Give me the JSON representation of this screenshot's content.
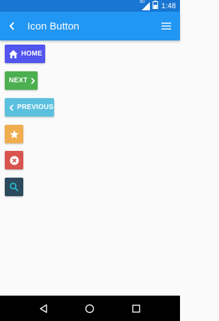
{
  "status_bar": {
    "network": "3G",
    "time": "1:48"
  },
  "app_bar": {
    "title": "Icon Button",
    "back_icon": "chevron-left-icon",
    "menu_icon": "hamburger-menu-icon"
  },
  "buttons": {
    "home": {
      "label": "HOME",
      "icon": "home-icon",
      "color": "#5255ee"
    },
    "next": {
      "label": "NEXT",
      "icon": "chevron-right-icon",
      "color": "#4caf50"
    },
    "previous": {
      "label": "PREVIOUS",
      "icon": "chevron-left-icon",
      "color": "#5bc0de"
    },
    "star": {
      "icon": "star-icon",
      "color": "#f0ad4e"
    },
    "close": {
      "icon": "close-circle-icon",
      "color": "#d9534f"
    },
    "search": {
      "icon": "search-icon",
      "color": "#2d4a5c"
    }
  },
  "nav_bar": {
    "back_icon": "nav-back-icon",
    "home_icon": "nav-home-icon",
    "recents_icon": "nav-recents-icon"
  },
  "colors": {
    "status_bar": "#1976d2",
    "app_bar": "#2196f3",
    "background": "#fafafa",
    "nav_bar": "#000000"
  }
}
